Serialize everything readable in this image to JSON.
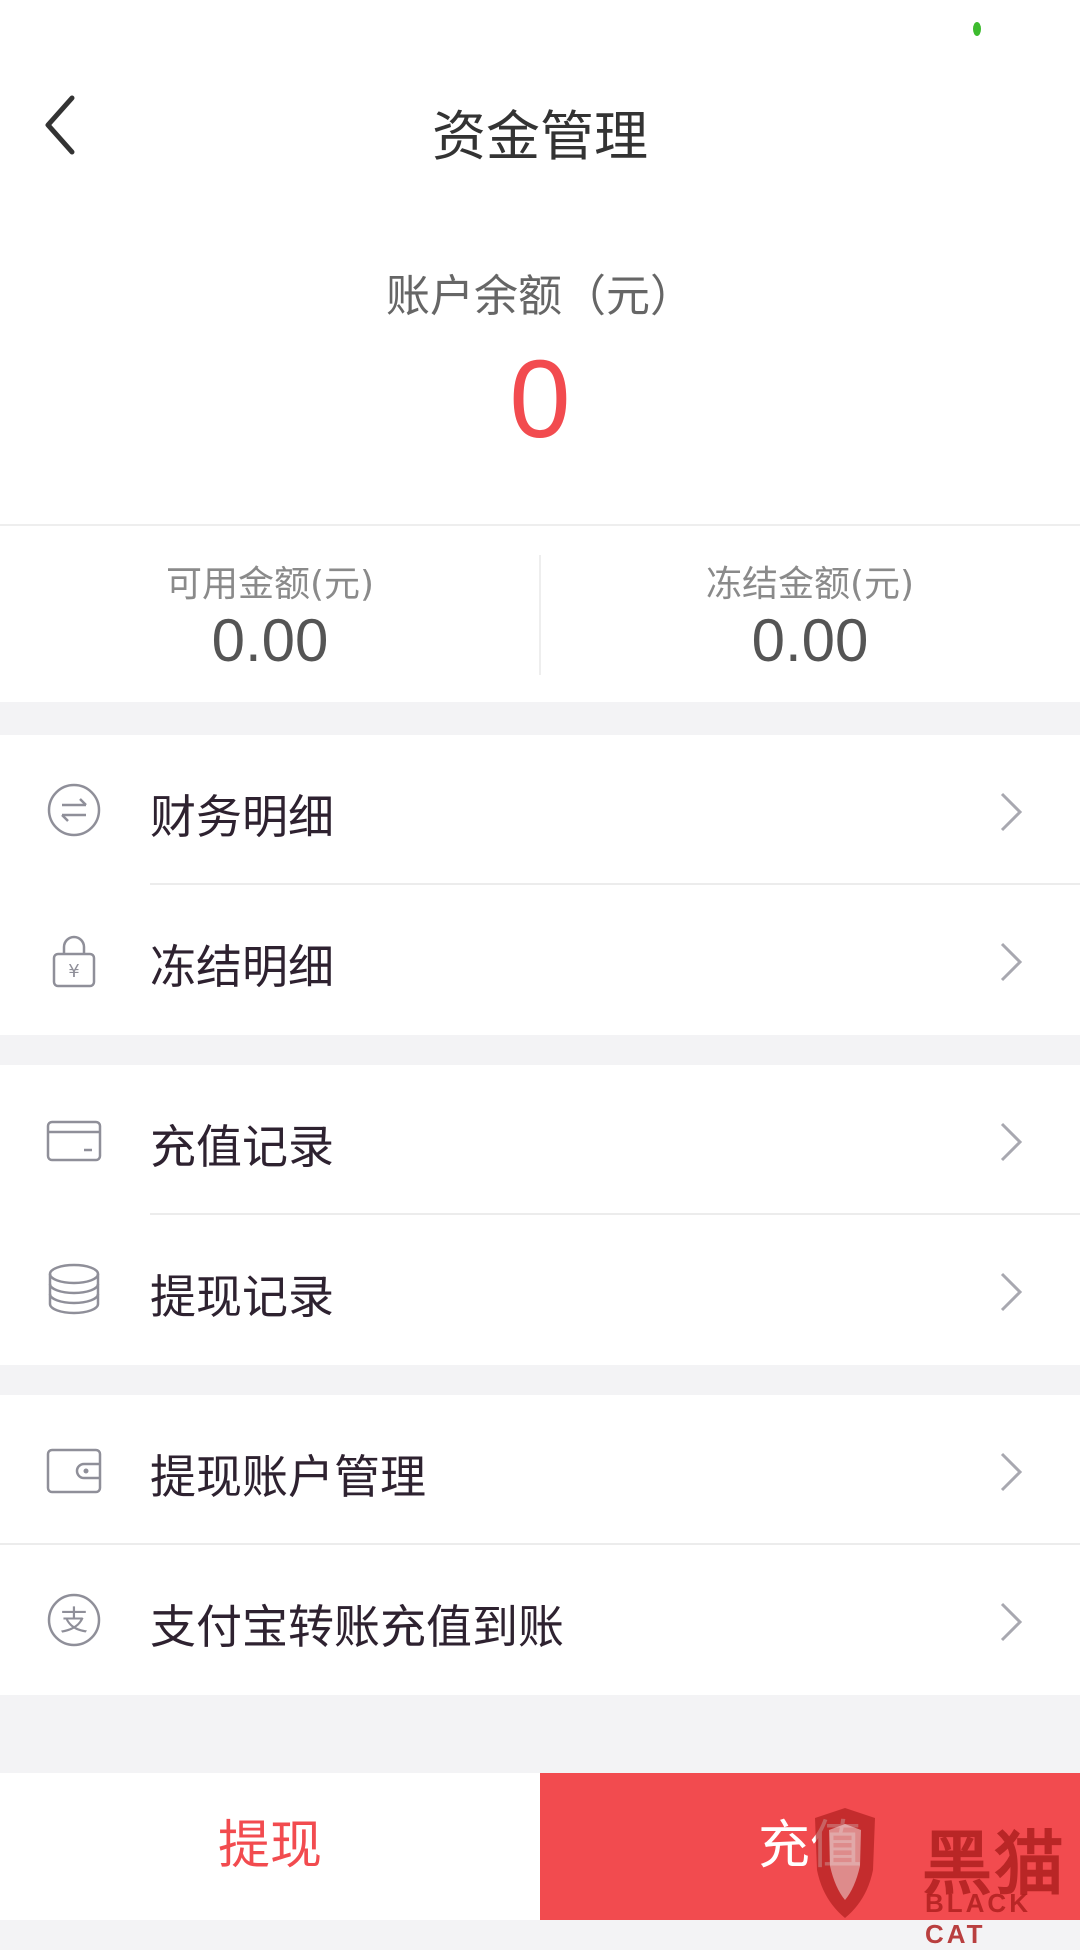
{
  "header": {
    "title": "资金管理",
    "back_icon": "chevron-left-icon"
  },
  "balance": {
    "label": "账户余额（元）",
    "value": "0"
  },
  "summary": {
    "available_label": "可用金额(元)",
    "available_value": "0.00",
    "frozen_label": "冻结金额(元)",
    "frozen_value": "0.00"
  },
  "menu": {
    "finance_details": {
      "label": "财务明细",
      "icon": "transfer-icon"
    },
    "frozen_details": {
      "label": "冻结明细",
      "icon": "lock-yuan-icon"
    },
    "recharge_records": {
      "label": "充值记录",
      "icon": "card-icon"
    },
    "withdraw_records": {
      "label": "提现记录",
      "icon": "coins-stack-icon"
    },
    "withdraw_account": {
      "label": "提现账户管理",
      "icon": "wallet-icon"
    },
    "alipay_transfer": {
      "label": "支付宝转账充值到账",
      "icon": "alipay-icon"
    }
  },
  "bottom": {
    "withdraw_label": "提现",
    "recharge_label": "充值"
  },
  "watermark": {
    "text": "黑猫",
    "sub": "BLACK CAT"
  },
  "colors": {
    "accent": "#f24b4f",
    "background": "#f3f3f5",
    "icon": "#8f8f99"
  }
}
